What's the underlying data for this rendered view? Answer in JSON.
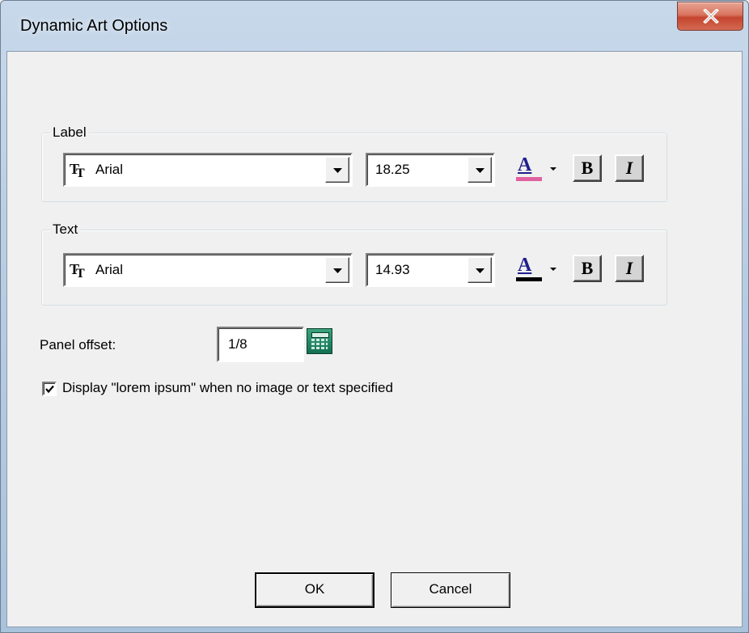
{
  "window": {
    "title": "Dynamic Art Options"
  },
  "label_group": {
    "title": "Label",
    "font": "Arial",
    "size": "18.25",
    "color_swatch": "#e060a0"
  },
  "text_group": {
    "title": "Text",
    "font": "Arial",
    "size": "14.93",
    "color_swatch": "#000000"
  },
  "style_buttons": {
    "bold": "B",
    "italic": "I",
    "color_glyph": "A"
  },
  "panel_offset": {
    "label": "Panel offset:",
    "value": "1/8"
  },
  "lorem_option": {
    "label": "Display \"lorem ipsum\" when no image or text specified",
    "checked": true
  },
  "buttons": {
    "ok": "OK",
    "cancel": "Cancel"
  },
  "icons": [
    "close-icon",
    "truetype-font-icon",
    "dropdown-arrow-icon",
    "font-color-icon",
    "calculator-icon",
    "checkmark-icon"
  ]
}
